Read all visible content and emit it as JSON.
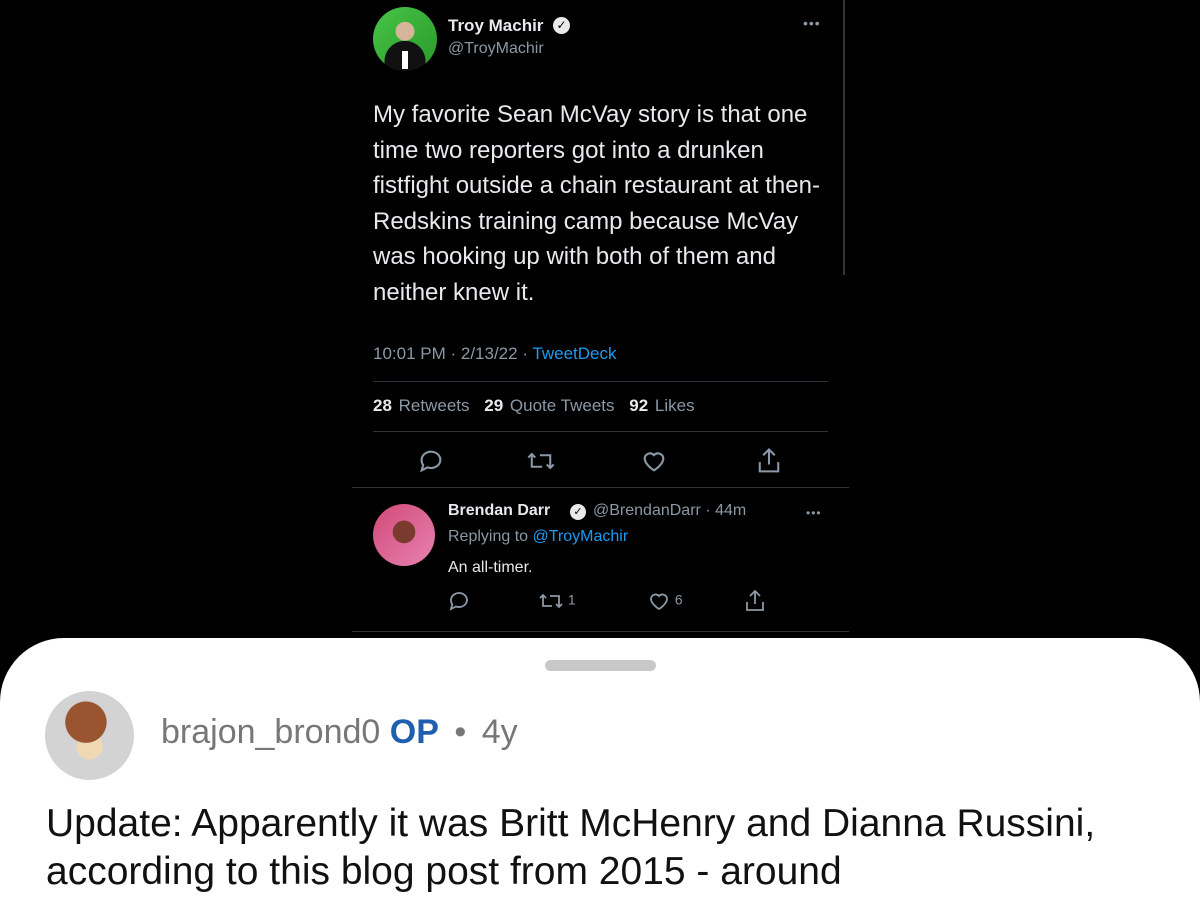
{
  "tweet": {
    "name": "Troy Machir",
    "handle": "@TroyMachir",
    "text": "My favorite Sean McVay story is that one time two reporters got into a drunken fistfight outside a chain restaurant at then-Redskins training camp because McVay was hooking up with both of them and neither knew it.",
    "time": "10:01 PM · 2/13/22 · ",
    "source": "TweetDeck",
    "stats": {
      "retweets_count": "28",
      "retweets_label": "Retweets",
      "quotes_count": "29",
      "quotes_label": "Quote Tweets",
      "likes_count": "92",
      "likes_label": "Likes"
    }
  },
  "reply": {
    "name": "Brendan Darr",
    "handle_time": "@BrendanDarr · 44m",
    "replying_prefix": "Replying to ",
    "replying_mention": "@TroyMachir",
    "text": "An all-timer.",
    "retweets": "1",
    "likes": "6"
  },
  "comment": {
    "username": "brajon_brond0",
    "op_badge": "OP",
    "separator": "•",
    "age": "4y",
    "text": "Update: Apparently it was Britt McHenry and Dianna Russini, according to this blog post from 2015 - around"
  },
  "icons": {
    "more": "•••",
    "verified": "✓"
  }
}
